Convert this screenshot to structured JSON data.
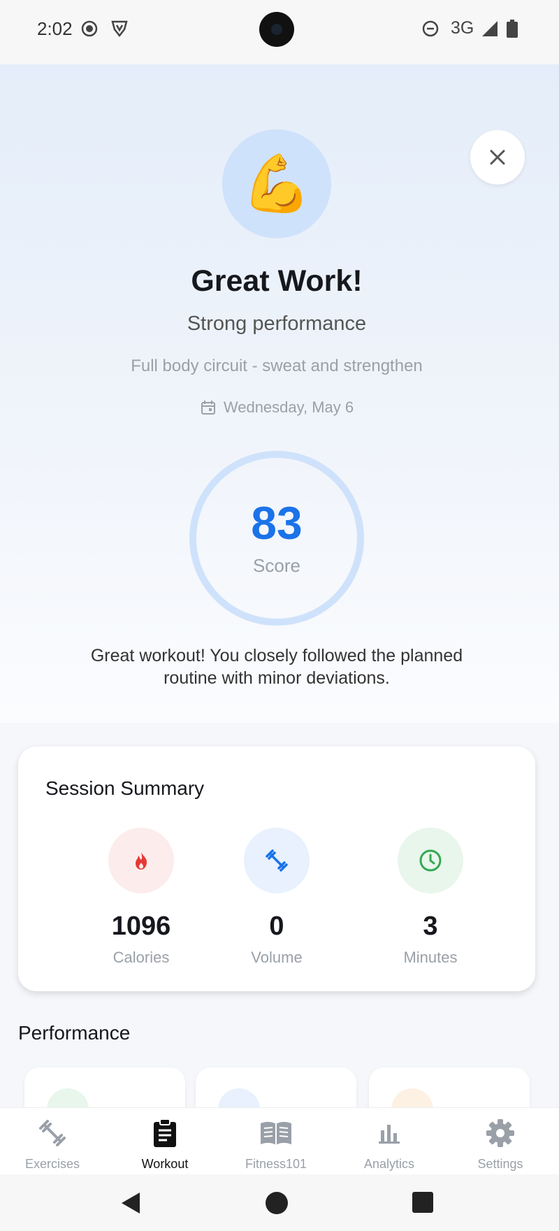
{
  "status_bar": {
    "time": "2:02",
    "network": "3G",
    "icons": [
      "record-icon",
      "vpn-shield-icon",
      "dnd-icon",
      "signal-icon",
      "battery-icon"
    ]
  },
  "hero": {
    "emoji": "💪",
    "title": "Great Work!",
    "subtitle": "Strong performance",
    "description": "Full body circuit - sweat and strengthen",
    "date": "Wednesday, May 6",
    "score": "83",
    "score_label": "Score",
    "feedback": "Great workout! You closely followed the planned routine with minor deviations."
  },
  "summary": {
    "title": "Session Summary",
    "stats": [
      {
        "value": "1096",
        "label": "Calories",
        "icon": "flame-icon",
        "color": "#e53935",
        "bg": "#fdecec"
      },
      {
        "value": "0",
        "label": "Volume",
        "icon": "dumbbell-icon",
        "color": "#1a73e8",
        "bg": "#e8f1fd"
      },
      {
        "value": "3",
        "label": "Minutes",
        "icon": "clock-icon",
        "color": "#34a853",
        "bg": "#e8f6ec"
      }
    ]
  },
  "performance": {
    "title": "Performance"
  },
  "nav": {
    "items": [
      {
        "label": "Exercises",
        "icon": "dumbbell-icon"
      },
      {
        "label": "Workout",
        "icon": "clipboard-icon",
        "active": true
      },
      {
        "label": "Fitness101",
        "icon": "book-icon"
      },
      {
        "label": "Analytics",
        "icon": "bar-chart-icon"
      },
      {
        "label": "Settings",
        "icon": "gear-icon"
      }
    ]
  },
  "colors": {
    "accent": "#1a73e8",
    "ring": "#cfe2fb"
  }
}
